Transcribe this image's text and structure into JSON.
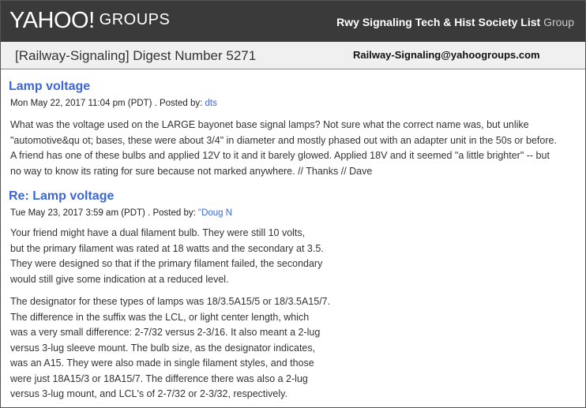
{
  "header": {
    "logo_text": "YAHOO!",
    "logo_groups": "GROUPS",
    "group_name": "Rwy Signaling Tech & Hist Society List",
    "group_suffix": "Group"
  },
  "subheader": {
    "digest_title": "[Railway-Signaling] Digest Number 5271",
    "list_email": "Railway-Signaling@yahoogroups.com"
  },
  "messages": [
    {
      "title": "Lamp voltage",
      "date": "Mon May 22, 2017 11:04 pm (PDT) . Posted by:",
      "author": "dts",
      "paragraphs": [
        [
          "What was the voltage used on the LARGE bayonet base signal lamps? Not sure what the correct name was, but unlike",
          "\"automotive&qu ot; bases, these were about 3/4\" in diameter and mostly phased out with an adapter unit in the 50s or before.",
          "A friend has one of these bulbs and applied 12V to it and it barely glowed. Applied 18V and it seemed \"a little brighter\" -- but",
          "no way to know its rating for sure because not marked anywhere. // Thanks // Dave"
        ]
      ]
    },
    {
      "title": "Re: Lamp voltage",
      "date": "Tue May 23, 2017 3:59 am (PDT) . Posted by:",
      "author": "\"Doug N",
      "paragraphs": [
        [
          "Your friend might have a dual filament bulb. They were still 10 volts,",
          "but the primary filament was rated at 18 watts and the secondary at 3.5.",
          "They were designed so that if the primary filament failed, the secondary",
          "would still give some indication at a reduced level."
        ],
        [
          "The designator for these types of lamps was 18/3.5A15/5 or 18/3.5A15/7.",
          "The difference in the suffix was the LCL, or light center length, which",
          "was a very small difference: 2-7/32 versus 2-3/16. It also meant a 2-lug",
          "versus 3-lug sleeve mount. The bulb size, as the designator indicates,",
          "was an A15. They were also made in single filament styles, and those",
          "were just 18A15/3 or 18A15/7. The difference there was also a 2-lug",
          "versus 3-lug mount, and LCL's of 2-7/32 or 2-3/32, respectively."
        ]
      ]
    }
  ]
}
